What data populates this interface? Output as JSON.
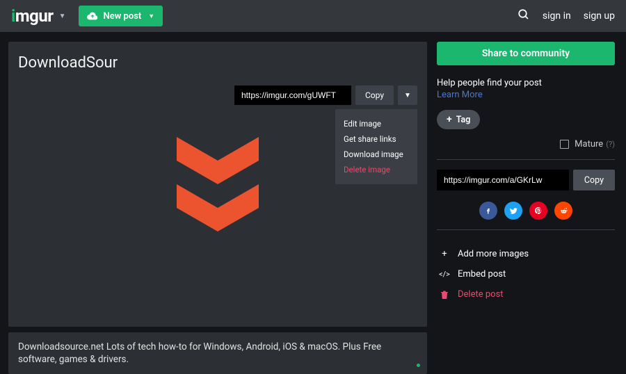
{
  "header": {
    "logo_text_pre": "i",
    "logo_text_post": "mgur",
    "new_post_label": "New post",
    "sign_in": "sign in",
    "sign_up": "sign up"
  },
  "post": {
    "title": "DownloadSour",
    "image_url": "https://imgur.com/gUWFT",
    "copy_label": "Copy",
    "dropdown": {
      "edit": "Edit image",
      "share": "Get share links",
      "download": "Download image",
      "delete": "Delete image"
    },
    "description": "Downloadsource.net Lots of tech how-to for Windows, Android, iOS & macOS. Plus Free software, games & drivers."
  },
  "sidebar": {
    "share_community": "Share to community",
    "help_text": "Help people find your post",
    "learn_more": "Learn More",
    "tag_label": "Tag",
    "mature_label": "Mature",
    "album_url": "https://imgur.com/a/GKrLw",
    "album_copy": "Copy",
    "actions": {
      "add_more": "Add more images",
      "embed": "Embed post",
      "delete": "Delete post"
    }
  },
  "icons": {
    "search": "search-icon",
    "cloud_upload": "cloud-upload-icon",
    "chevron_down": "chevron-down-icon",
    "plus": "plus-icon",
    "facebook": "facebook-icon",
    "twitter": "twitter-icon",
    "pinterest": "pinterest-icon",
    "reddit": "reddit-icon",
    "embed": "embed-icon",
    "trash": "trash-icon",
    "help": "help-icon"
  },
  "colors": {
    "accent": "#1bb76e",
    "danger": "#e84b6e",
    "chevron_orange": "#ec5430"
  }
}
